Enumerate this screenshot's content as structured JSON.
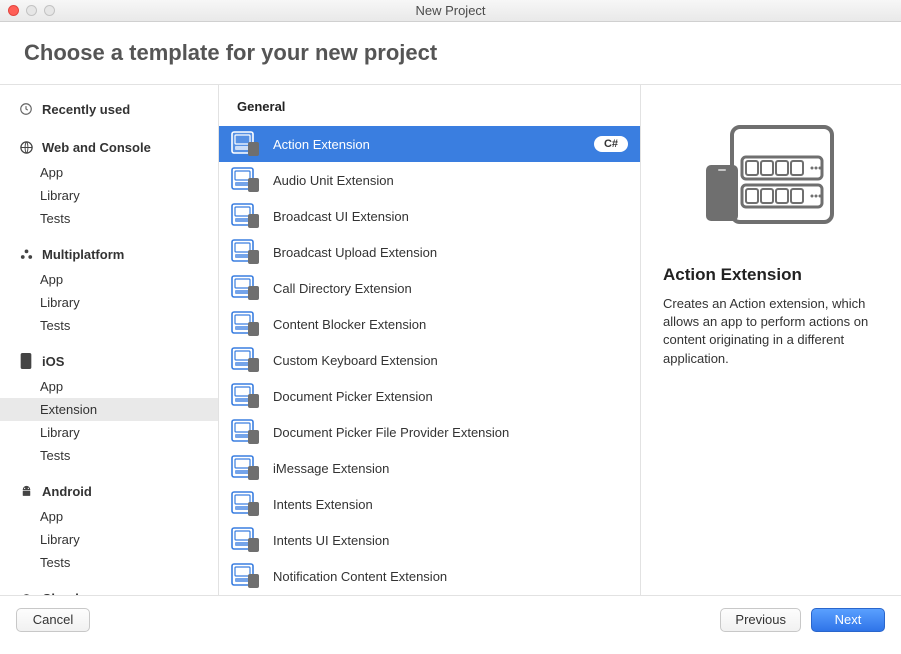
{
  "window": {
    "title": "New Project"
  },
  "header": {
    "title": "Choose a template for your new project"
  },
  "sidebar": {
    "recently_used_label": "Recently used",
    "sections": [
      {
        "title": "Web and Console",
        "icon": "web-icon",
        "items": [
          "App",
          "Library",
          "Tests"
        ]
      },
      {
        "title": "Multiplatform",
        "icon": "multiplatform-icon",
        "items": [
          "App",
          "Library",
          "Tests"
        ]
      },
      {
        "title": "iOS",
        "icon": "ios-icon",
        "items": [
          "App",
          "Extension",
          "Library",
          "Tests"
        ],
        "selected_item_index": 1
      },
      {
        "title": "Android",
        "icon": "android-icon",
        "items": [
          "App",
          "Library",
          "Tests"
        ]
      },
      {
        "title": "Cloud",
        "icon": "cloud-icon",
        "items": []
      }
    ]
  },
  "templates": {
    "group_label": "General",
    "items": [
      {
        "name": "Action Extension",
        "badge": "C#",
        "selected": true
      },
      {
        "name": "Audio Unit Extension"
      },
      {
        "name": "Broadcast UI Extension"
      },
      {
        "name": "Broadcast Upload Extension"
      },
      {
        "name": "Call Directory Extension"
      },
      {
        "name": "Content Blocker Extension"
      },
      {
        "name": "Custom Keyboard Extension"
      },
      {
        "name": "Document Picker Extension"
      },
      {
        "name": "Document Picker File Provider Extension"
      },
      {
        "name": "iMessage Extension"
      },
      {
        "name": "Intents Extension"
      },
      {
        "name": "Intents UI Extension"
      },
      {
        "name": "Notification Content Extension"
      }
    ]
  },
  "detail": {
    "title": "Action Extension",
    "description": "Creates an Action extension, which allows an app to perform actions on content originating in a different application."
  },
  "footer": {
    "cancel": "Cancel",
    "previous": "Previous",
    "next": "Next"
  }
}
